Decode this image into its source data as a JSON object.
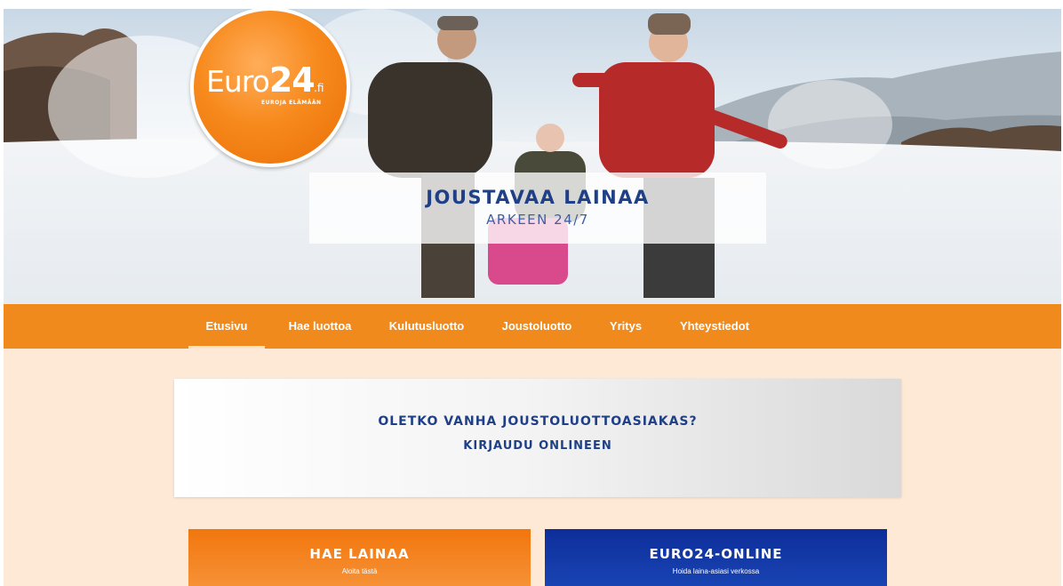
{
  "brand": {
    "logo_name": "Euro",
    "logo_number": "24",
    "logo_tld": ".fi",
    "tagline": "EUROJA ELÄMÄÄN"
  },
  "hero": {
    "title": "Joustavaa lainaa",
    "subtitle": "ARKEEN 24/7"
  },
  "nav": {
    "items": [
      {
        "label": "Etusivu",
        "active": true
      },
      {
        "label": "Hae luottoa"
      },
      {
        "label": "Kulutusluotto"
      },
      {
        "label": "Joustoluotto"
      },
      {
        "label": "Yritys"
      },
      {
        "label": "Yhteystiedot"
      }
    ]
  },
  "login_card": {
    "question": "Oletko vanha Joustoluottoasiakas?",
    "link": "Kirjaudu Onlineen"
  },
  "cta": {
    "apply": {
      "title": "Hae lainaa",
      "subtitle": "Aloita tästä"
    },
    "online": {
      "title": "Euro24-online",
      "subtitle": "Hoida laina-asiasi verkossa"
    }
  },
  "colors": {
    "brand_orange": "#f08a1d",
    "brand_navy": "#1f3f87",
    "page_bg": "#fde9d6",
    "online_blue": "#0d2e9a"
  },
  "icons": {
    "hero_image": "winter-family-snow-photo"
  }
}
